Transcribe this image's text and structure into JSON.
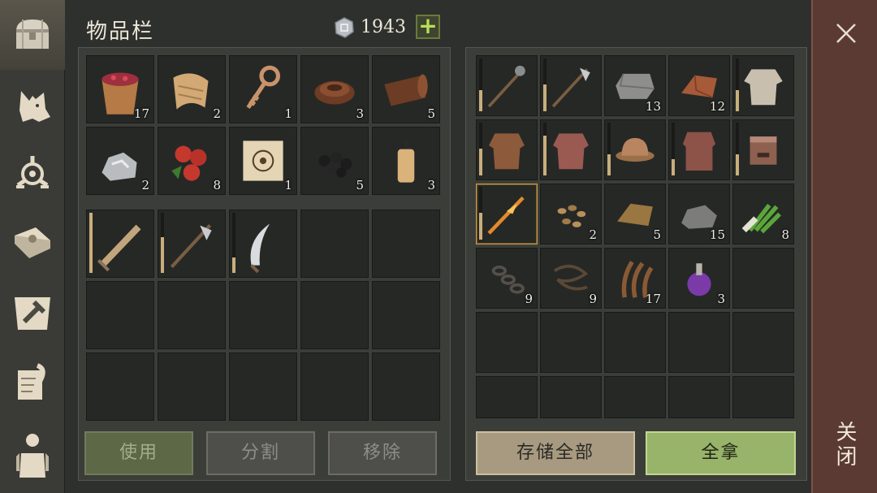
{
  "title": "物品栏",
  "currency": {
    "icon": "silver-coin-icon",
    "value": "1943",
    "add_label": "+"
  },
  "tabs": [
    {
      "name": "chest-icon",
      "active": true
    },
    {
      "name": "wolf-icon",
      "active": false
    },
    {
      "name": "sigil-icon",
      "active": false
    },
    {
      "name": "sun-book-icon",
      "active": false
    },
    {
      "name": "hammer-map-icon",
      "active": false
    },
    {
      "name": "quill-scroll-icon",
      "active": false
    },
    {
      "name": "character-icon",
      "active": false
    }
  ],
  "inventory": {
    "materials": [
      {
        "icon": "berry-bucket-icon",
        "qty": "17"
      },
      {
        "icon": "cloth-scrap-icon",
        "qty": "2"
      },
      {
        "icon": "ornate-key-icon",
        "qty": "1"
      },
      {
        "icon": "leather-coil-icon",
        "qty": "3"
      },
      {
        "icon": "leather-roll-icon",
        "qty": "5"
      },
      {
        "icon": "iron-ore-icon",
        "qty": "2"
      },
      {
        "icon": "red-berries-icon",
        "qty": "8"
      },
      {
        "icon": "map-scroll-icon",
        "qty": "1"
      },
      {
        "icon": "coal-icon",
        "qty": "5"
      },
      {
        "icon": "candle-icon",
        "qty": "3"
      }
    ],
    "equipment": [
      {
        "icon": "sword-icon",
        "durability": 1.0
      },
      {
        "icon": "halberd-icon",
        "durability": 0.6
      },
      {
        "icon": "sickle-icon",
        "durability": 0.25
      }
    ]
  },
  "storage": [
    {
      "icon": "mace-icon",
      "durability": 0.4
    },
    {
      "icon": "poleaxe-icon",
      "durability": 0.5
    },
    {
      "icon": "stone-block-icon",
      "qty": "13"
    },
    {
      "icon": "copper-ingot-icon",
      "qty": "12"
    },
    {
      "icon": "linen-shirt-icon",
      "durability": 0.4
    },
    {
      "icon": "leather-armor-icon",
      "durability": 0.5
    },
    {
      "icon": "chainmail-icon",
      "durability": 0.75
    },
    {
      "icon": "iron-hat-icon",
      "durability": 0.4
    },
    {
      "icon": "mail-coat-icon",
      "durability": 0.3
    },
    {
      "icon": "great-helm-icon",
      "durability": 0.4
    },
    {
      "icon": "flaming-spear-icon",
      "durability": 0.5,
      "selected": true
    },
    {
      "icon": "seeds-icon",
      "qty": "2"
    },
    {
      "icon": "bronze-ingot-icon",
      "qty": "5"
    },
    {
      "icon": "stone-icon",
      "qty": "15"
    },
    {
      "icon": "leek-icon",
      "qty": "8"
    },
    {
      "icon": "iron-chain-icon",
      "qty": "9"
    },
    {
      "icon": "rope-icon",
      "qty": "9"
    },
    {
      "icon": "fiber-icon",
      "qty": "17"
    },
    {
      "icon": "purple-potion-icon",
      "qty": "3"
    }
  ],
  "buttons": {
    "use": "使用",
    "split": "分割",
    "remove": "移除",
    "store_all": "存储全部",
    "take_all": "全拿"
  },
  "close": {
    "label": "关闭",
    "icon": "close-icon"
  },
  "colors": {
    "take_all": "#98b36a",
    "store_all": "#a79a80",
    "use": "#5d6847",
    "close_panel": "#5a3a32",
    "durability": "#c9ae7c"
  }
}
